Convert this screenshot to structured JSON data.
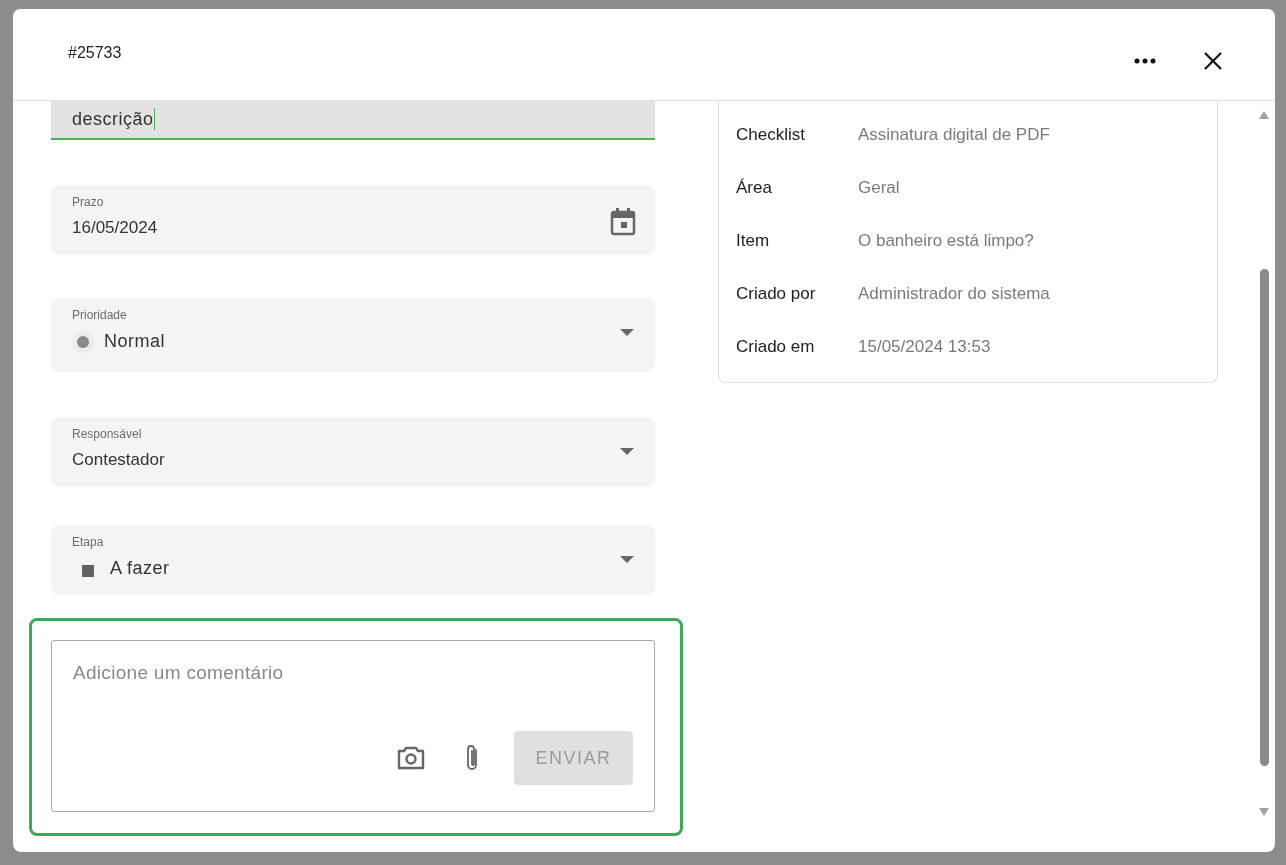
{
  "dialog": {
    "title": "#25733"
  },
  "description": {
    "value": "descrição",
    "focused": true
  },
  "fields": [
    {
      "kind": "date",
      "label": "Prazo",
      "value": "16/05/2024"
    },
    {
      "kind": "priority",
      "label": "Prioridade",
      "value": "Normal",
      "color": "#8a8a8a"
    },
    {
      "kind": "select",
      "label": "Responsável",
      "value": "Contestador"
    },
    {
      "kind": "stage",
      "label": "Etapa",
      "value": "A fazer",
      "color": "#616161"
    }
  ],
  "comment": {
    "placeholder": "Adicione um comentário",
    "focused": true,
    "send_button": {
      "label": "ENVIAR",
      "disabled": true
    }
  },
  "details": [
    {
      "label": "Checklist",
      "value": "Assinatura digital de PDF"
    },
    {
      "label": "Área",
      "value": "Geral"
    },
    {
      "label": "Item",
      "value": "O banheiro está limpo?"
    },
    {
      "label": "Criado por",
      "value": "Administrador do sistema"
    },
    {
      "label": "Criado em",
      "value": "15/05/2024 13:53"
    }
  ]
}
